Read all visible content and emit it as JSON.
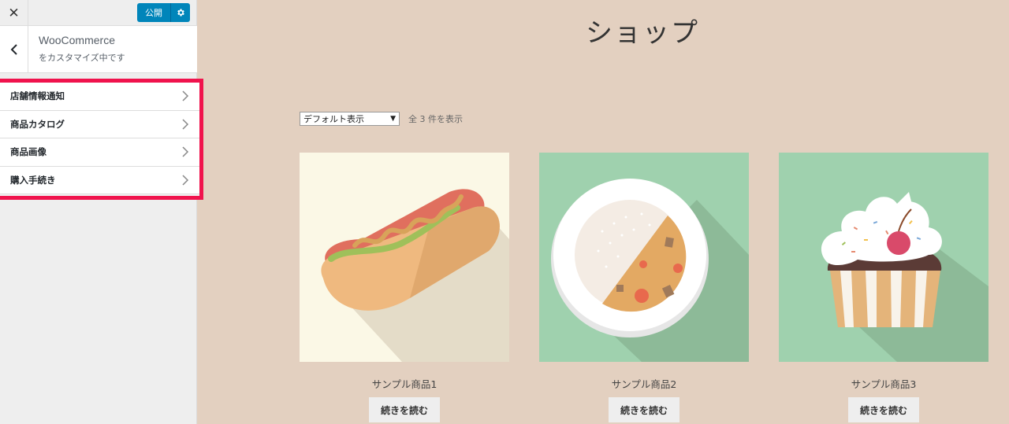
{
  "sidebar": {
    "close_label": "✕",
    "publish_label": "公開",
    "panel_title": "WooCommerce",
    "panel_subtitle": "をカスタマイズ中です",
    "sections": [
      {
        "label": "店舗情報通知"
      },
      {
        "label": "商品カタログ"
      },
      {
        "label": "商品画像"
      },
      {
        "label": "購入手続き"
      }
    ],
    "highlight_color": "#f0134d",
    "publish_color": "#0085ba"
  },
  "preview": {
    "page_title": "ショップ",
    "sort_select_value": "デフォルト表示",
    "result_count": "全 3 件を表示",
    "products": [
      {
        "name": "サンプル商品1",
        "button": "続きを読む",
        "image": "hotdog-image"
      },
      {
        "name": "サンプル商品2",
        "button": "続きを読む",
        "image": "curry-plate-image"
      },
      {
        "name": "サンプル商品3",
        "button": "続きを読む",
        "image": "cupcake-image"
      }
    ],
    "background_color": "#e3d0c0"
  }
}
